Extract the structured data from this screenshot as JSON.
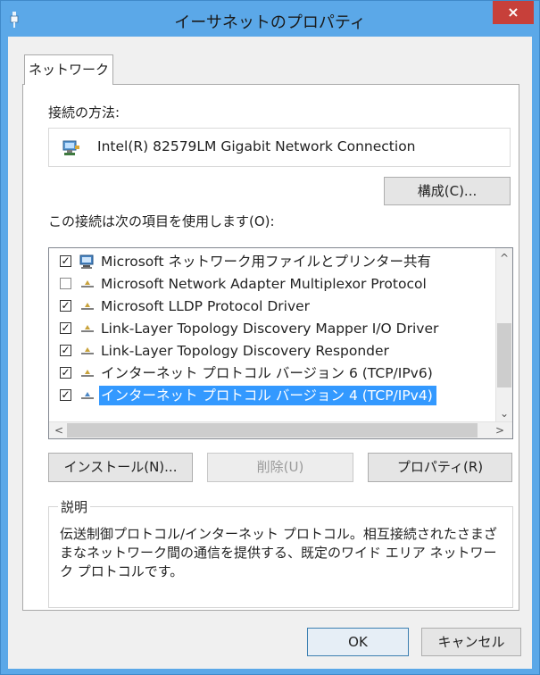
{
  "window": {
    "title": "イーサネットのプロパティ",
    "close_label": "×"
  },
  "tab": {
    "label": "ネットワーク"
  },
  "connection": {
    "label": "接続の方法:",
    "adapter_name": "Intel(R) 82579LM Gigabit Network Connection",
    "configure_label": "構成(C)..."
  },
  "items_label": "この接続は次の項目を使用します(O):",
  "items": [
    {
      "checked": true,
      "icon": "network-client-icon",
      "label": "Microsoft ネットワーク用ファイルとプリンター共有"
    },
    {
      "checked": false,
      "icon": "protocol-icon",
      "label": "Microsoft Network Adapter Multiplexor Protocol"
    },
    {
      "checked": true,
      "icon": "protocol-icon",
      "label": "Microsoft LLDP Protocol Driver"
    },
    {
      "checked": true,
      "icon": "protocol-icon",
      "label": "Link-Layer Topology Discovery Mapper I/O Driver"
    },
    {
      "checked": true,
      "icon": "protocol-icon",
      "label": "Link-Layer Topology Discovery Responder"
    },
    {
      "checked": true,
      "icon": "protocol-icon",
      "label": "インターネット プロトコル バージョン 6 (TCP/IPv6)"
    },
    {
      "checked": true,
      "icon": "protocol-icon",
      "label": "インターネット プロトコル バージョン 4 (TCP/IPv4)",
      "selected": true
    }
  ],
  "buttons": {
    "install": "インストール(N)...",
    "uninstall": "削除(U)",
    "properties": "プロパティ(R)"
  },
  "description": {
    "title": "説明",
    "text": "伝送制御プロトコル/インターネット プロトコル。相互接続されたさまざまなネットワーク間の通信を提供する、既定のワイド エリア ネットワーク プロトコルです。"
  },
  "footer": {
    "ok": "OK",
    "cancel": "キャンセル"
  },
  "colors": {
    "titlebar": "#5ba8e8",
    "close": "#c7403a",
    "selection": "#3399ff"
  }
}
